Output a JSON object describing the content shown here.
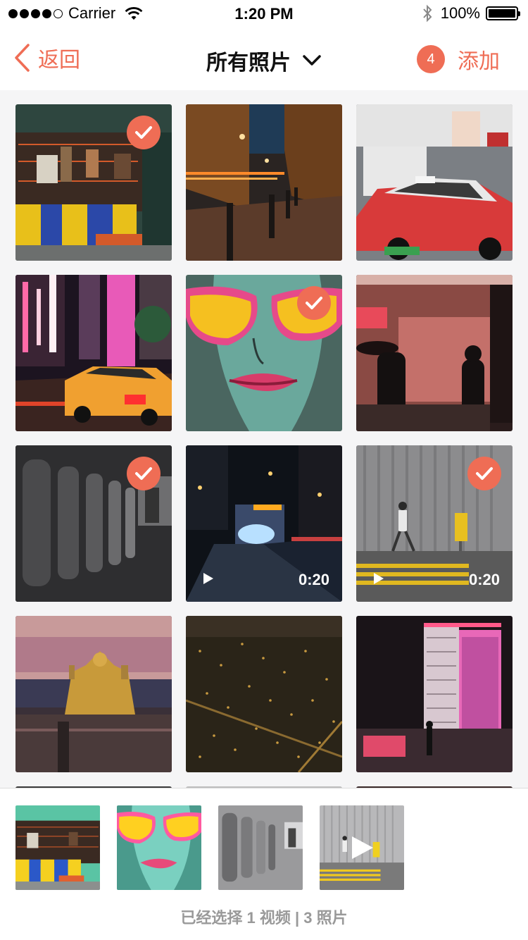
{
  "status_bar": {
    "carrier": "Carrier",
    "time": "1:20 PM",
    "battery": "100%",
    "battery_level": 1.0
  },
  "nav": {
    "back_label": "返回",
    "title": "所有照片",
    "badge_count": "4",
    "add_label": "添加",
    "accent_color": "#ef6d55"
  },
  "grid": {
    "items": [
      {
        "kind": "photo",
        "selected": true
      },
      {
        "kind": "photo",
        "selected": false
      },
      {
        "kind": "photo",
        "selected": false
      },
      {
        "kind": "photo",
        "selected": false
      },
      {
        "kind": "photo",
        "selected": true
      },
      {
        "kind": "photo",
        "selected": false
      },
      {
        "kind": "photo",
        "selected": true
      },
      {
        "kind": "video",
        "selected": false,
        "duration": "0:20"
      },
      {
        "kind": "video",
        "selected": true,
        "duration": "0:20"
      },
      {
        "kind": "photo",
        "selected": false
      },
      {
        "kind": "photo",
        "selected": false
      },
      {
        "kind": "photo",
        "selected": false
      }
    ]
  },
  "tray": {
    "summary": "已经选择 1 视频 | 3 照片"
  }
}
